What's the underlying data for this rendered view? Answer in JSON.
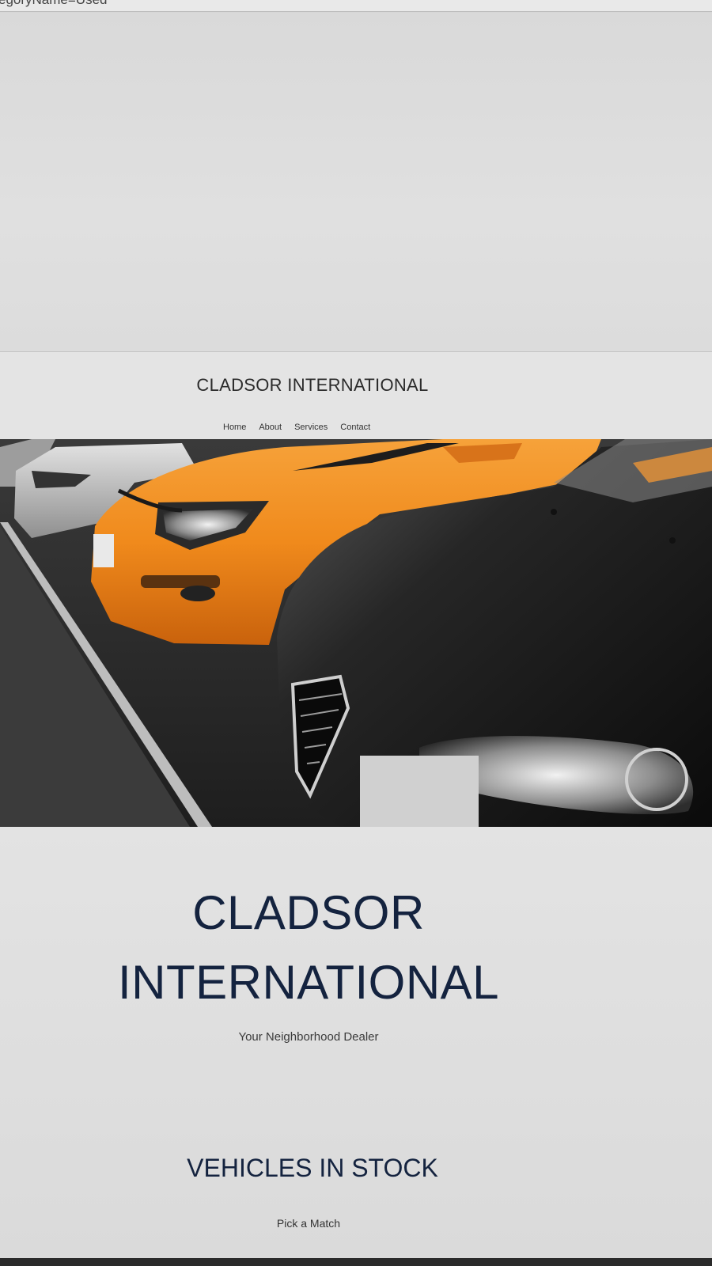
{
  "browser": {
    "url_fragment": "egoryName=Used"
  },
  "header": {
    "brand": "CLADSOR INTERNATIONAL",
    "nav": [
      "Home",
      "About",
      "Services",
      "Contact"
    ]
  },
  "hero": {
    "image": "parked-cars-photo",
    "colors": {
      "orange_car": "#f08a1c",
      "black_car": "#161616",
      "silver_car": "#b9b9b9",
      "asphalt": "#2b2b2b"
    }
  },
  "main": {
    "title_line1": "CLADSOR",
    "title_line2": "INTERNATIONAL",
    "tagline": "Your Neighborhood Dealer",
    "section_title": "VEHICLES IN STOCK",
    "section_subtitle": "Pick a Match"
  },
  "theme": {
    "title_color": "#14233f",
    "background": "#e0e0e0"
  }
}
